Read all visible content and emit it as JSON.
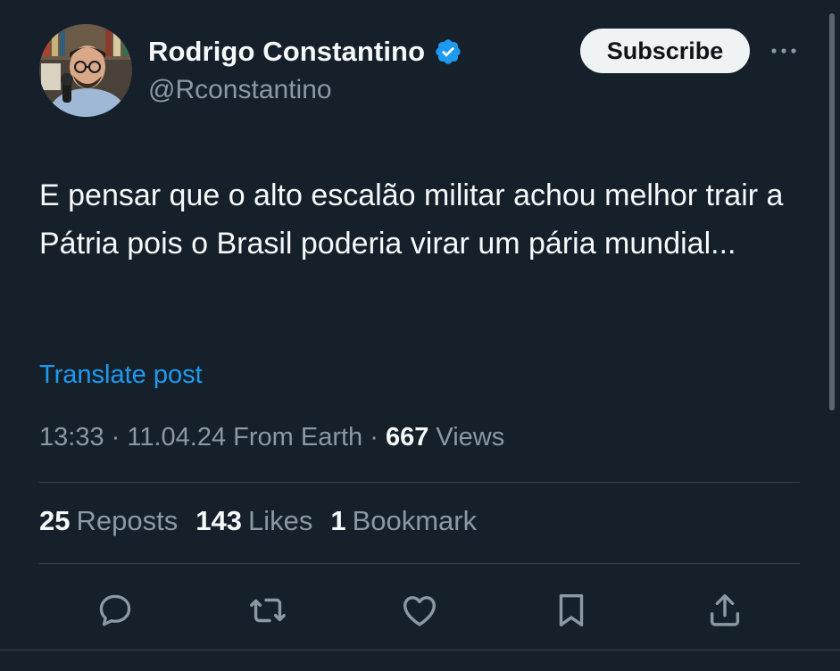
{
  "author": {
    "display_name": "Rodrigo Constantino",
    "handle": "@Rconstantino",
    "verified": true
  },
  "header": {
    "subscribe_label": "Subscribe",
    "more_icon": "ellipsis-icon"
  },
  "post": {
    "text": "E pensar que o alto escalão militar achou melhor trair a Pátria pois o Brasil poderia virar um pária mundial...",
    "translate_label": "Translate post",
    "time": "13:33",
    "date": "11.04.24",
    "source": "From Earth",
    "views_count": "667",
    "views_label": "Views"
  },
  "stats": {
    "reposts_count": "25",
    "reposts_label": "Reposts",
    "likes_count": "143",
    "likes_label": "Likes",
    "bookmarks_count": "1",
    "bookmarks_label": "Bookmark"
  },
  "actions": [
    "reply-icon",
    "repost-icon",
    "like-icon",
    "bookmark-icon",
    "share-icon"
  ],
  "colors": {
    "background": "#15202b",
    "text_primary": "#f7f9f9",
    "text_secondary": "#8b98a5",
    "link": "#1d9bf0",
    "verified": "#1d9bf0",
    "divider": "#38444d",
    "button_bg": "#eff3f4"
  }
}
